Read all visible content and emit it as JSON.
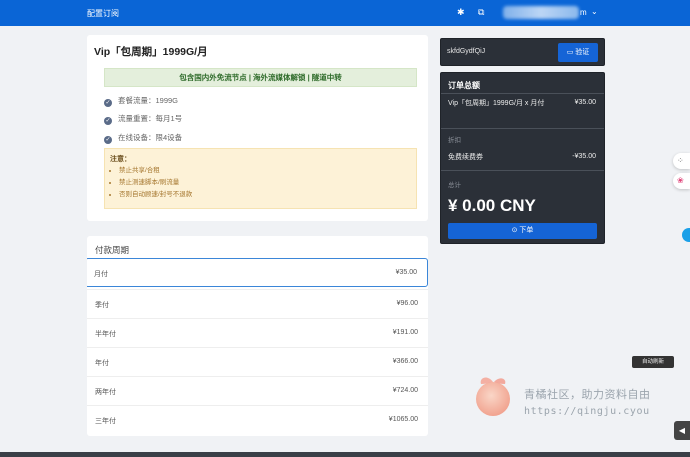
{
  "topbar": {
    "title": "配置订阅",
    "settings_icon": "gear-icon",
    "language_icon": "language-icon",
    "user_tail": "m",
    "caret_icon": "chevron-down-icon"
  },
  "plan": {
    "title": "Vip「包周期」1999G/月",
    "highlight": "包含国内外免流节点 | 海外流媒体解锁 | 隧道中转",
    "features": [
      "套餐流量：1999G",
      "流量重置：每月1号",
      "在线设备：限4设备"
    ],
    "notice_title": "注意：",
    "notice_items": [
      "禁止共享/合租",
      "禁止测速脚本/刷流量",
      "否则自动顾速/封号不退款"
    ]
  },
  "periods": {
    "heading": "付款周期",
    "items": [
      {
        "name": "月付",
        "price": "¥35.00"
      },
      {
        "name": "季付",
        "price": "¥96.00"
      },
      {
        "name": "半年付",
        "price": "¥191.00"
      },
      {
        "name": "年付",
        "price": "¥366.00"
      },
      {
        "name": "两年付",
        "price": "¥724.00"
      },
      {
        "name": "三年付",
        "price": "¥1065.00"
      }
    ]
  },
  "coupon": {
    "code": "skfdGydfQiJ",
    "verify_label": "验证"
  },
  "summary": {
    "title": "订单总额",
    "item_name": "Vip「包周期」1999G/月 x 月付",
    "item_price": "¥35.00",
    "discount_label": "折扣",
    "discount_name": "免费续费券",
    "discount_price": "-¥35.00",
    "total_label": "总计",
    "total": "¥ 0.00 CNY",
    "order_label": "下单"
  },
  "side": {
    "tooltip": "自动刷新"
  },
  "watermark": {
    "line1": "青橘社区，助力资料自由",
    "line2": "https://qingju.cyou"
  },
  "colors": {
    "brand_blue": "#0a65d6",
    "dark_panel": "#2b3038"
  }
}
